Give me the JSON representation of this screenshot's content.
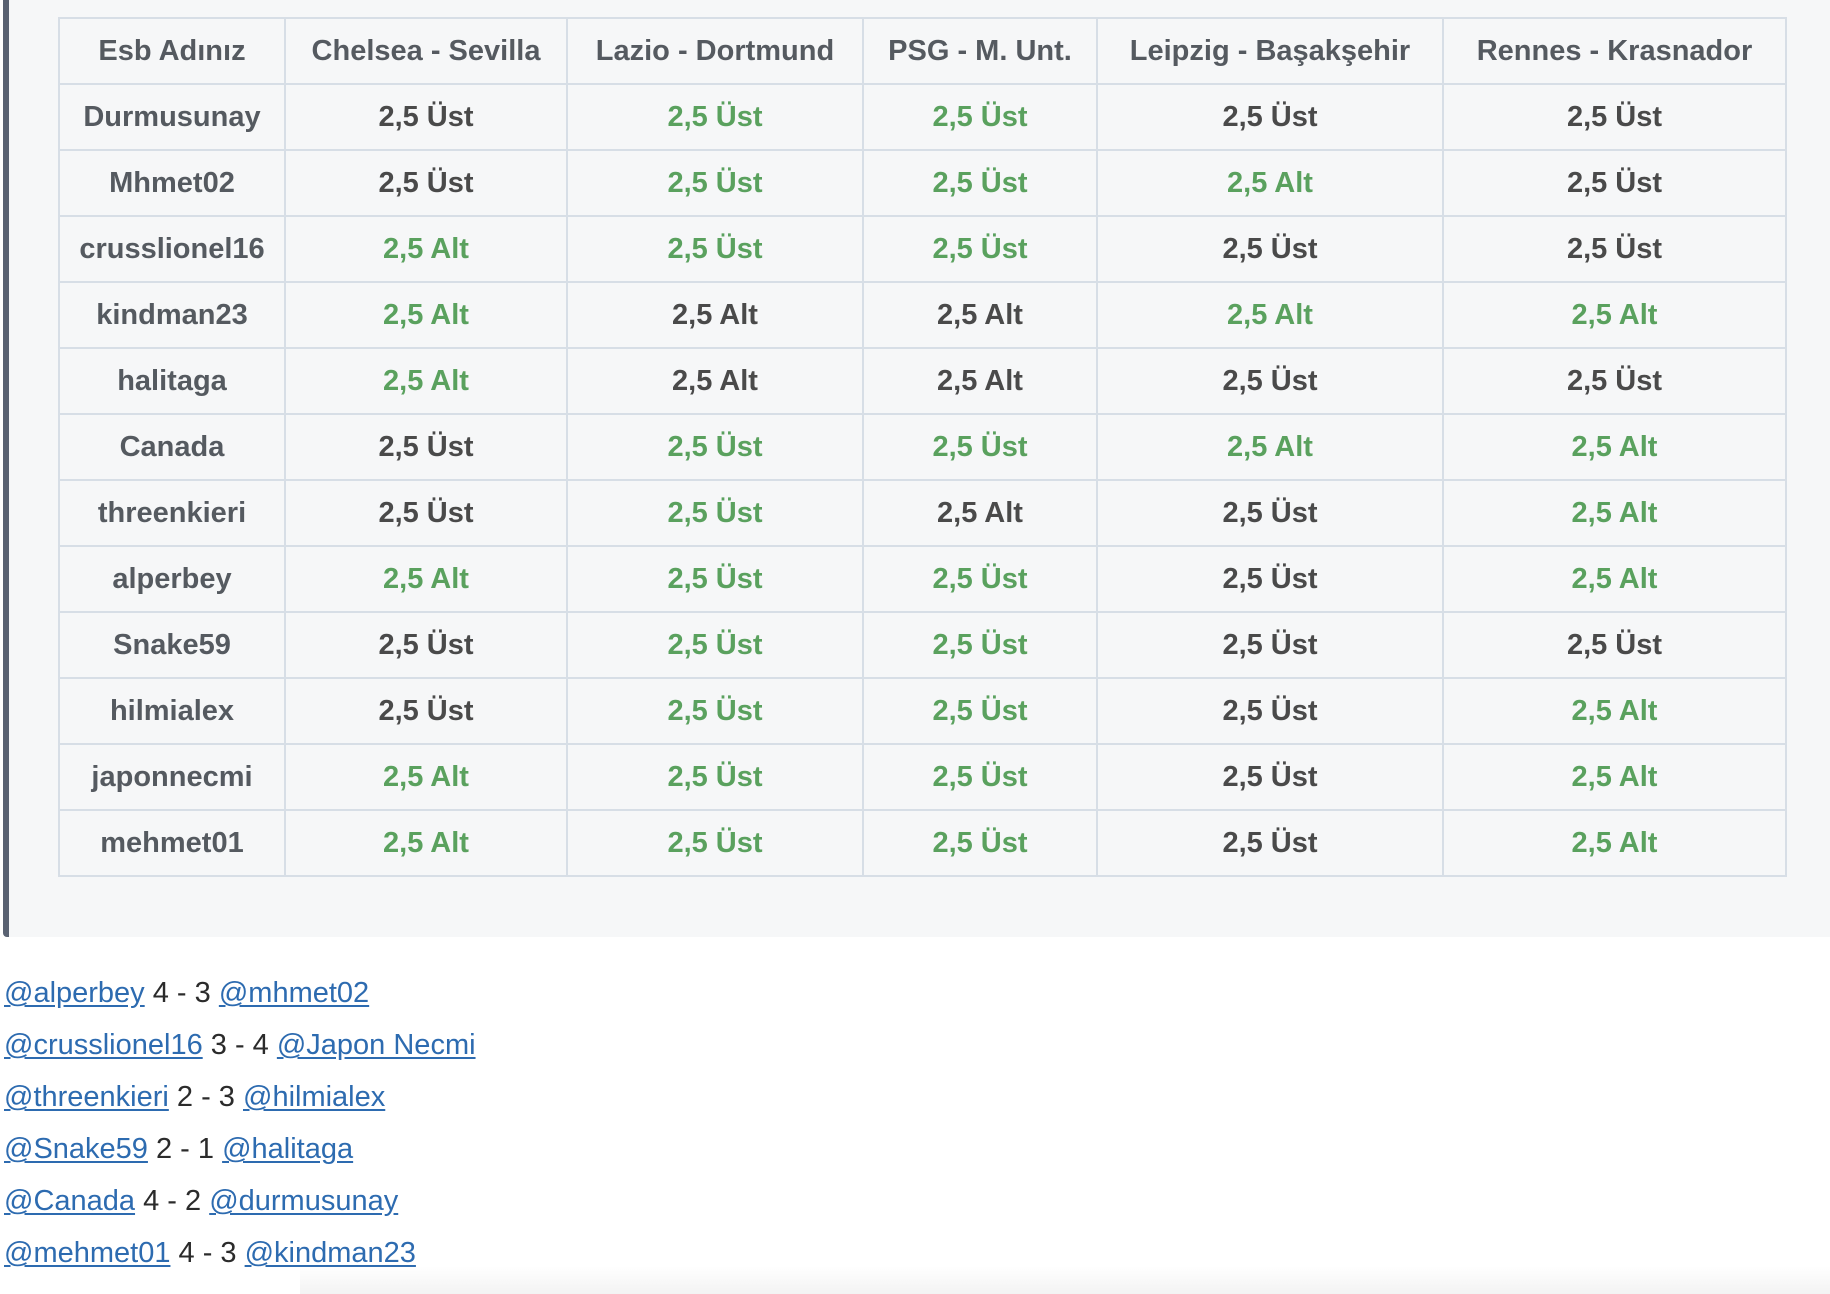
{
  "table": {
    "headers": [
      "Esb Adınız",
      "Chelsea - Sevilla",
      "Lazio - Dortmund",
      "PSG - M. Unt.",
      "Leipzig - Başakşehir",
      "Rennes - Krasnador"
    ],
    "rows": [
      {
        "name": "Durmusunay",
        "picks": [
          "2,5 Üst",
          "2,5 Üst",
          "2,5 Üst",
          "2,5 Üst",
          "2,5 Üst"
        ],
        "correct": [
          false,
          true,
          true,
          false,
          false
        ]
      },
      {
        "name": "Mhmet02",
        "picks": [
          "2,5 Üst",
          "2,5 Üst",
          "2,5 Üst",
          "2,5 Alt",
          "2,5 Üst"
        ],
        "correct": [
          false,
          true,
          true,
          true,
          false
        ]
      },
      {
        "name": "crusslionel16",
        "picks": [
          "2,5 Alt",
          "2,5 Üst",
          "2,5 Üst",
          "2,5 Üst",
          "2,5 Üst"
        ],
        "correct": [
          true,
          true,
          true,
          false,
          false
        ]
      },
      {
        "name": "kindman23",
        "picks": [
          "2,5 Alt",
          "2,5 Alt",
          "2,5 Alt",
          "2,5 Alt",
          "2,5 Alt"
        ],
        "correct": [
          true,
          false,
          false,
          true,
          true
        ]
      },
      {
        "name": "halitaga",
        "picks": [
          "2,5 Alt",
          "2,5 Alt",
          "2,5 Alt",
          "2,5 Üst",
          "2,5 Üst"
        ],
        "correct": [
          true,
          false,
          false,
          false,
          false
        ]
      },
      {
        "name": "Canada",
        "picks": [
          "2,5 Üst",
          "2,5 Üst",
          "2,5 Üst",
          "2,5 Alt",
          "2,5 Alt"
        ],
        "correct": [
          false,
          true,
          true,
          true,
          true
        ]
      },
      {
        "name": "threenkieri",
        "picks": [
          "2,5 Üst",
          "2,5 Üst",
          "2,5 Alt",
          "2,5 Üst",
          "2,5 Alt"
        ],
        "correct": [
          false,
          true,
          false,
          false,
          true
        ]
      },
      {
        "name": "alperbey",
        "picks": [
          "2,5 Alt",
          "2,5 Üst",
          "2,5 Üst",
          "2,5 Üst",
          "2,5 Alt"
        ],
        "correct": [
          true,
          true,
          true,
          false,
          true
        ]
      },
      {
        "name": "Snake59",
        "picks": [
          "2,5 Üst",
          "2,5 Üst",
          "2,5 Üst",
          "2,5 Üst",
          "2,5 Üst"
        ],
        "correct": [
          false,
          true,
          true,
          false,
          false
        ]
      },
      {
        "name": "hilmialex",
        "picks": [
          "2,5 Üst",
          "2,5 Üst",
          "2,5 Üst",
          "2,5 Üst",
          "2,5 Alt"
        ],
        "correct": [
          false,
          true,
          true,
          false,
          true
        ]
      },
      {
        "name": "japonnecmi",
        "picks": [
          "2,5 Alt",
          "2,5 Üst",
          "2,5 Üst",
          "2,5 Üst",
          "2,5 Alt"
        ],
        "correct": [
          true,
          true,
          true,
          false,
          true
        ]
      },
      {
        "name": "mehmet01",
        "picks": [
          "2,5 Alt",
          "2,5 Üst",
          "2,5 Üst",
          "2,5 Üst",
          "2,5 Alt"
        ],
        "correct": [
          true,
          true,
          true,
          false,
          true
        ]
      }
    ],
    "colors": {
      "correct": "#5aa15e",
      "default": "#4a4a4a"
    }
  },
  "results": [
    {
      "home": "@alperbey",
      "score": "4 - 3",
      "away": "@mhmet02"
    },
    {
      "home": "@crusslionel16",
      "score": "3 - 4",
      "away": "@Japon Necmi"
    },
    {
      "home": "@threenkieri",
      "score": "2 - 3",
      "away": "@hilmialex"
    },
    {
      "home": "@Snake59",
      "score": "2 - 1",
      "away": "@halitaga"
    },
    {
      "home": "@Canada",
      "score": "4 - 2",
      "away": "@durmusunay"
    },
    {
      "home": "@mehmet01",
      "score": "4 - 3",
      "away": "@kindman23"
    }
  ]
}
